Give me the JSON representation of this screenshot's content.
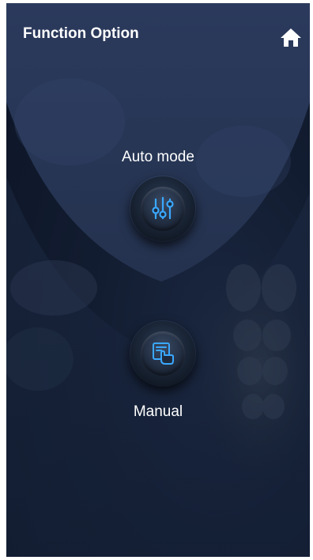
{
  "header": {
    "title": "Function Option",
    "home_icon": "home-icon"
  },
  "modes": {
    "auto": {
      "label": "Auto mode",
      "icon": "sliders-icon"
    },
    "manual": {
      "label": "Manual",
      "icon": "hand-touch-icon"
    }
  },
  "colors": {
    "background": "#121c30",
    "accent": "#3aa8ff",
    "text": "#ffffff"
  }
}
